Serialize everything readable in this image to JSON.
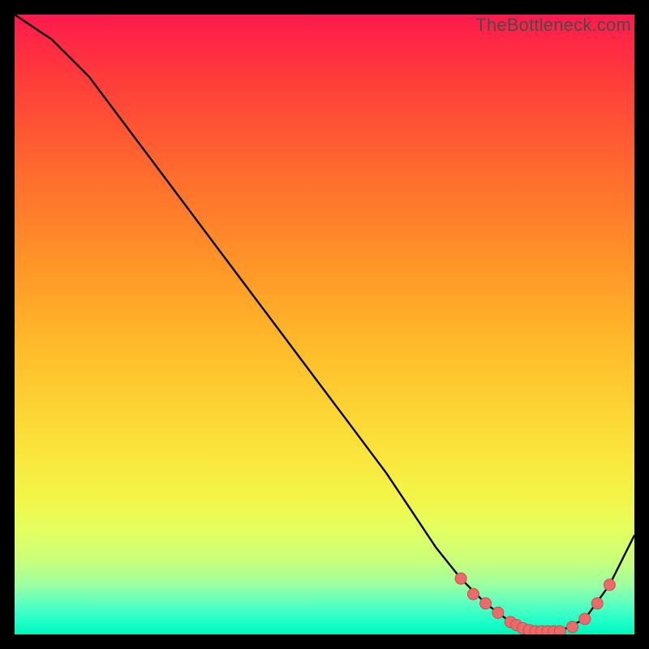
{
  "watermark": "TheBottleneck.com",
  "colors": {
    "curve": "#000000",
    "marker_fill": "#ed6a6a",
    "marker_stroke": "#c94f4f",
    "gradient_top": "#ff1a4d",
    "gradient_bottom": "#00f5b8",
    "background": "#000000"
  },
  "chart_data": {
    "type": "line",
    "title": "",
    "xlabel": "",
    "ylabel": "",
    "xlim": [
      0,
      100
    ],
    "ylim": [
      0,
      100
    ],
    "series": [
      {
        "name": "curve",
        "x": [
          0,
          6,
          12,
          18,
          24,
          30,
          36,
          42,
          48,
          54,
          60,
          64,
          68,
          72,
          76,
          80,
          84,
          88,
          92,
          96,
          100
        ],
        "y": [
          100,
          96,
          90,
          82,
          74,
          66,
          58,
          50,
          42,
          34,
          26,
          20,
          14,
          9,
          5,
          2,
          0.5,
          0.5,
          2.5,
          8,
          16
        ]
      },
      {
        "name": "markers",
        "x": [
          72,
          74,
          76,
          78,
          80,
          81,
          82,
          83,
          84,
          85,
          86,
          87,
          88,
          90,
          92,
          94,
          96
        ],
        "y": [
          9,
          6.5,
          5,
          3.5,
          2,
          1.5,
          1,
          0.7,
          0.5,
          0.5,
          0.5,
          0.5,
          0.5,
          1.2,
          2.5,
          5,
          8
        ]
      }
    ]
  }
}
